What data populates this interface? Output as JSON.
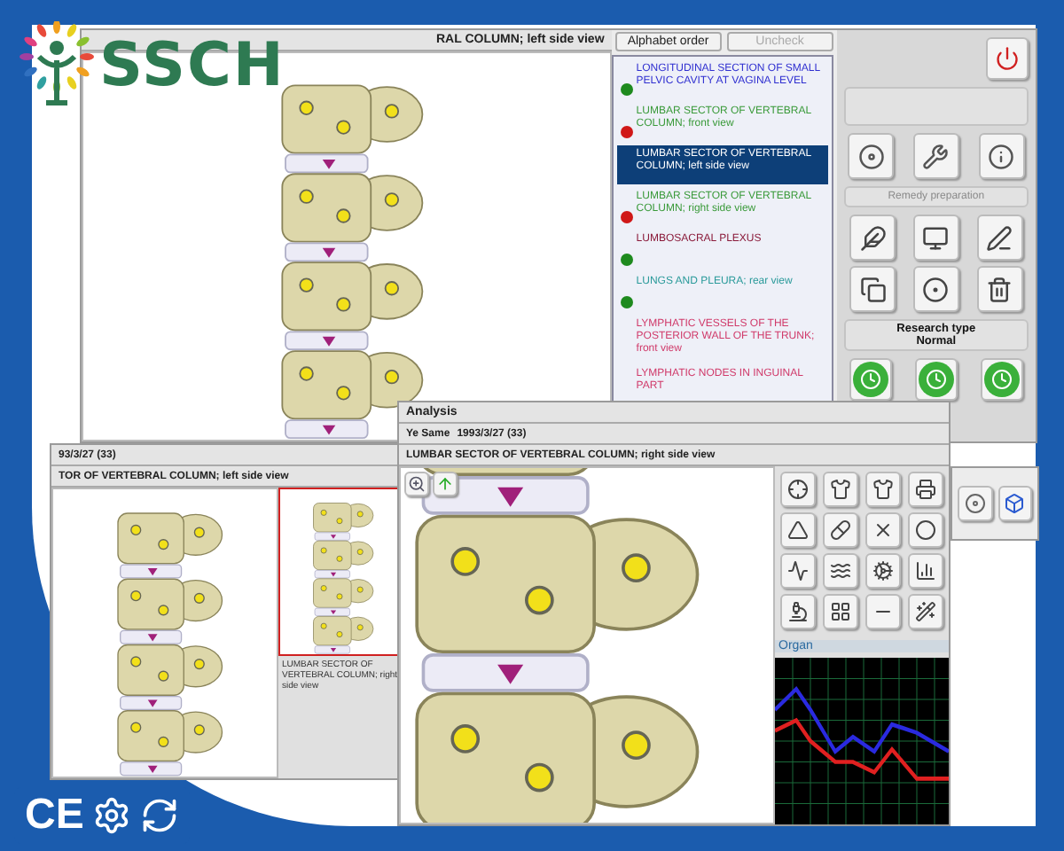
{
  "brand": {
    "name": "SSCH"
  },
  "certifications": {
    "mark": "CE"
  },
  "main_window": {
    "title": "RAL COLUMN; left side view",
    "buttons": [
      {
        "label": "Alphabet order",
        "disabled": false
      },
      {
        "label": "Uncheck",
        "disabled": true
      }
    ],
    "list": [
      {
        "label": "LONGITUDINAL SECTION OF SMALL PELVIC CAVITY AT VAGINA LEVEL",
        "kind": "section",
        "color": "#1e8a1e",
        "selected": false
      },
      {
        "label": "LUMBAR SECTOR OF VERTEBRAL COLUMN; front view",
        "kind": "skeleton",
        "color": "#d01818",
        "selected": false
      },
      {
        "label": "LUMBAR SECTOR OF VERTEBRAL COLUMN; left side view",
        "selected": true
      },
      {
        "label": "LUMBAR SECTOR OF VERTEBRAL COLUMN; right side view",
        "kind": "skeleton",
        "color": "#d01818",
        "selected": false
      },
      {
        "label": "LUMBOSACRAL PLEXUS",
        "kind": "nerve",
        "color": "#1e8a1e",
        "selected": false
      },
      {
        "label": "LUNGS AND PLEURA; rear view",
        "kind": "organ",
        "color": "#1e8a1e",
        "selected": false
      },
      {
        "label": "LYMPHATIC VESSELS OF THE POSTERIOR WALL OF THE TRUNK; front view",
        "kind": "lymph",
        "selected": false
      },
      {
        "label": "LYMPHATIC NODES IN INGUINAL PART",
        "kind": "lymph",
        "selected": false
      }
    ],
    "side_panel": {
      "section_label": "Remedy preparation",
      "section_disabled": true,
      "research_type_label": "Research type",
      "research_type_value": "Normal"
    }
  },
  "report_window": {
    "date": "93/3/27 (33)",
    "title": "TOR OF VERTEBRAL COLUMN; left side view",
    "thumbnail_caption": "LUMBAR SECTOR OF VERTEBRAL COLUMN; right side view"
  },
  "analysis_window": {
    "title": "Analysis",
    "patient_label": "Ye Same",
    "patient_value": "1993/3/27 (33)",
    "view_title": "LUMBAR SECTOR OF VERTEBRAL COLUMN; right side view",
    "panel_title": "Organ"
  }
}
